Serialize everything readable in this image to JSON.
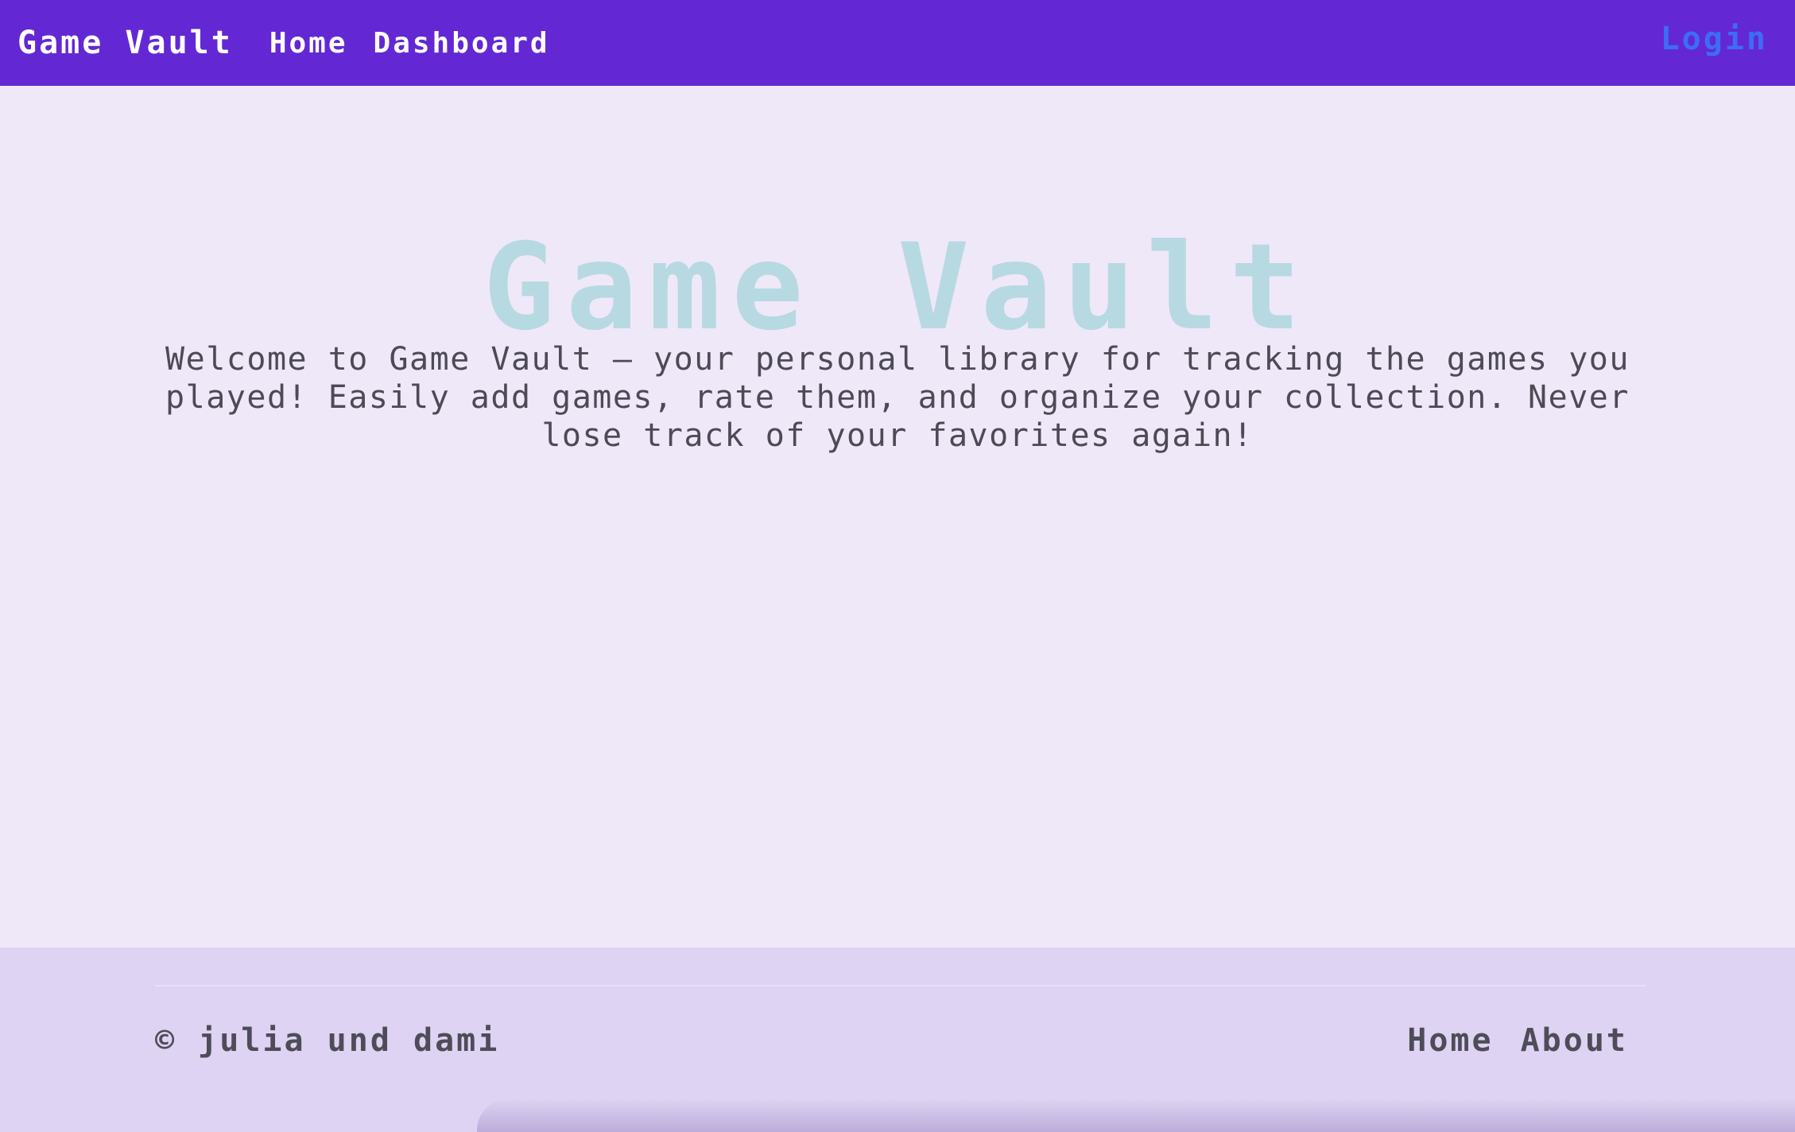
{
  "navbar": {
    "brand": "Game Vault",
    "links": [
      "Home",
      "Dashboard"
    ],
    "login": "Login"
  },
  "hero": {
    "title": "Game Vault",
    "description": "Welcome to Game Vault – your personal library for tracking the games you played! Easily add games, rate them, and organize your collection. Never lose track of your favorites again!"
  },
  "footer": {
    "copyright": "© julia und dami",
    "links": [
      "Home",
      "About"
    ]
  },
  "colors": {
    "navbar": "#6328d4",
    "page": "#efe8f8",
    "footer": "#ded3f3",
    "hero_title": "#b7d9e2",
    "login": "#3d6cf6"
  }
}
